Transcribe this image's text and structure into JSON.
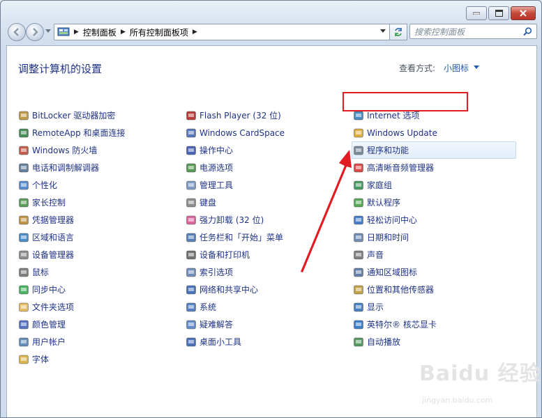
{
  "window": {
    "close_label": "✕"
  },
  "address": {
    "crumbs": [
      "控制面板",
      "所有控制面板项"
    ]
  },
  "search": {
    "placeholder": "搜索控制面板"
  },
  "header": {
    "title": "调整计算机的设置",
    "view_by_label": "查看方式:",
    "view_by_value": "小图标"
  },
  "columns": [
    [
      {
        "label": "BitLocker 驱动器加密",
        "icon": "bitlocker-icon",
        "color": "#b48a2a"
      },
      {
        "label": "RemoteApp 和桌面连接",
        "icon": "remoteapp-icon",
        "color": "#2a7a3a"
      },
      {
        "label": "Windows 防火墙",
        "icon": "firewall-icon",
        "color": "#b8412e"
      },
      {
        "label": "电话和调制解调器",
        "icon": "phone-modem-icon",
        "color": "#4a6a8a"
      },
      {
        "label": "个性化",
        "icon": "personalization-icon",
        "color": "#3b7ac8"
      },
      {
        "label": "家长控制",
        "icon": "parental-control-icon",
        "color": "#3e8e3e"
      },
      {
        "label": "凭据管理器",
        "icon": "credential-icon",
        "color": "#b8822a"
      },
      {
        "label": "区域和语言",
        "icon": "region-icon",
        "color": "#2a7ac0"
      },
      {
        "label": "设备管理器",
        "icon": "device-manager-icon",
        "color": "#7a7a7a"
      },
      {
        "label": "鼠标",
        "icon": "mouse-icon",
        "color": "#6a6a6a"
      },
      {
        "label": "同步中心",
        "icon": "sync-icon",
        "color": "#2aa64a"
      },
      {
        "label": "文件夹选项",
        "icon": "folder-icon",
        "color": "#e0b04a"
      },
      {
        "label": "颜色管理",
        "icon": "color-management-icon",
        "color": "#3a5ab8"
      },
      {
        "label": "用户帐户",
        "icon": "user-accounts-icon",
        "color": "#4a7ab0"
      },
      {
        "label": "字体",
        "icon": "fonts-icon",
        "color": "#d8a830"
      }
    ],
    [
      {
        "label": "Flash Player (32 位)",
        "icon": "flash-icon",
        "color": "#b01818"
      },
      {
        "label": "Windows CardSpace",
        "icon": "cardspace-icon",
        "color": "#3a62b0"
      },
      {
        "label": "操作中心",
        "icon": "action-center-icon",
        "color": "#2a4aa8"
      },
      {
        "label": "电源选项",
        "icon": "power-icon",
        "color": "#3a8a3a"
      },
      {
        "label": "管理工具",
        "icon": "admin-tools-icon",
        "color": "#6a8ab8"
      },
      {
        "label": "键盘",
        "icon": "keyboard-icon",
        "color": "#7a7a7a"
      },
      {
        "label": "强力卸载 (32 位)",
        "icon": "uninstall-icon",
        "color": "#d84a8a"
      },
      {
        "label": "任务栏和「开始」菜单",
        "icon": "taskbar-icon",
        "color": "#3a6ab0"
      },
      {
        "label": "设备和打印机",
        "icon": "printer-icon",
        "color": "#5a5a5a"
      },
      {
        "label": "索引选项",
        "icon": "indexing-icon",
        "color": "#5a7ab0"
      },
      {
        "label": "网络和共享中心",
        "icon": "network-icon",
        "color": "#2a5ab0"
      },
      {
        "label": "系统",
        "icon": "system-icon",
        "color": "#3a6ab8"
      },
      {
        "label": "疑难解答",
        "icon": "troubleshoot-icon",
        "color": "#4a7ac0"
      },
      {
        "label": "桌面小工具",
        "icon": "gadgets-icon",
        "color": "#2a5ab0"
      }
    ],
    [
      {
        "label": "Internet 选项",
        "icon": "internet-options-icon",
        "color": "#2a7ab8"
      },
      {
        "label": "Windows Update",
        "icon": "windows-update-icon",
        "color": "#d8a020"
      },
      {
        "label": "程序和功能",
        "icon": "programs-icon",
        "color": "#6a7a8a",
        "selected": true
      },
      {
        "label": "高清晰音频管理器",
        "icon": "audio-manager-icon",
        "color": "#d82a2a"
      },
      {
        "label": "家庭组",
        "icon": "homegroup-icon",
        "color": "#2a8a4a"
      },
      {
        "label": "默认程序",
        "icon": "default-programs-icon",
        "color": "#3a9a3a"
      },
      {
        "label": "轻松访问中心",
        "icon": "ease-of-access-icon",
        "color": "#2a6ac0"
      },
      {
        "label": "日期和时间",
        "icon": "clock-icon",
        "color": "#5a7aa8"
      },
      {
        "label": "声音",
        "icon": "sound-icon",
        "color": "#6a6a6a"
      },
      {
        "label": "通知区域图标",
        "icon": "notification-icon",
        "color": "#4a6a9a"
      },
      {
        "label": "位置和其他传感器",
        "icon": "sensor-icon",
        "color": "#b8942a"
      },
      {
        "label": "显示",
        "icon": "display-icon",
        "color": "#2a6ab8"
      },
      {
        "label": "英特尔® 核芯显卡",
        "icon": "intel-graphics-icon",
        "color": "#1a6ac0"
      },
      {
        "label": "自动播放",
        "icon": "autoplay-icon",
        "color": "#3a8a4a"
      }
    ]
  ],
  "watermark": {
    "brand": "Baidu 经验",
    "url": "jingyan.baidu.com"
  },
  "annotation_color": "#e21a22"
}
